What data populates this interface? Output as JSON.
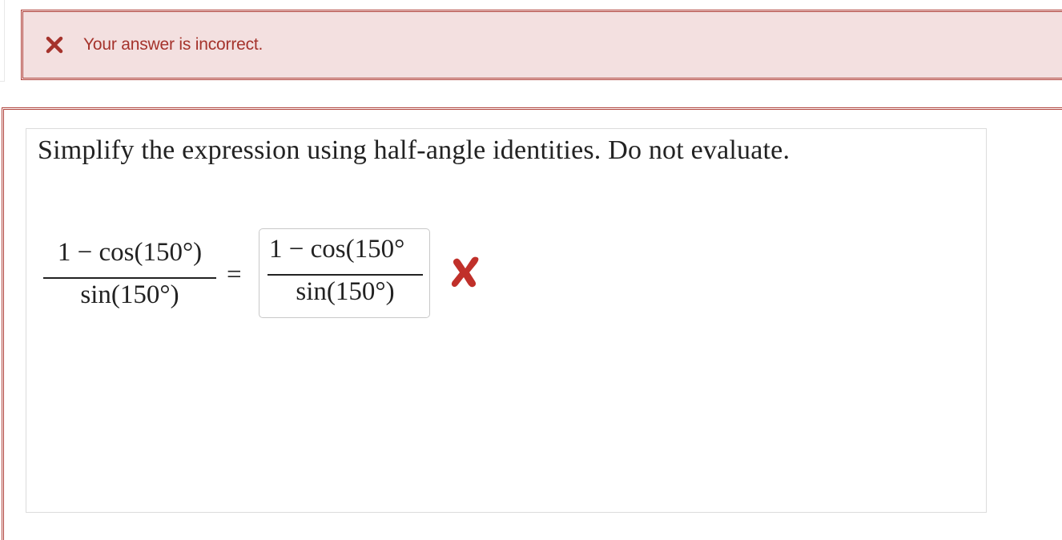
{
  "feedback": {
    "icon": "close-icon",
    "message": "Your answer is incorrect.",
    "color": "#a5332c",
    "background": "#f3e0e0"
  },
  "question": {
    "prompt": "Simplify the expression using half-angle identities. Do not evaluate.",
    "lhs": {
      "numerator": "1 − cos(150°)",
      "denominator": "sin(150°)"
    },
    "equals": "=",
    "answer": {
      "numerator": "1 − cos(150°",
      "denominator": "sin(150°)"
    },
    "result_icon": "incorrect-x-icon",
    "result_color": "#c0302a"
  }
}
